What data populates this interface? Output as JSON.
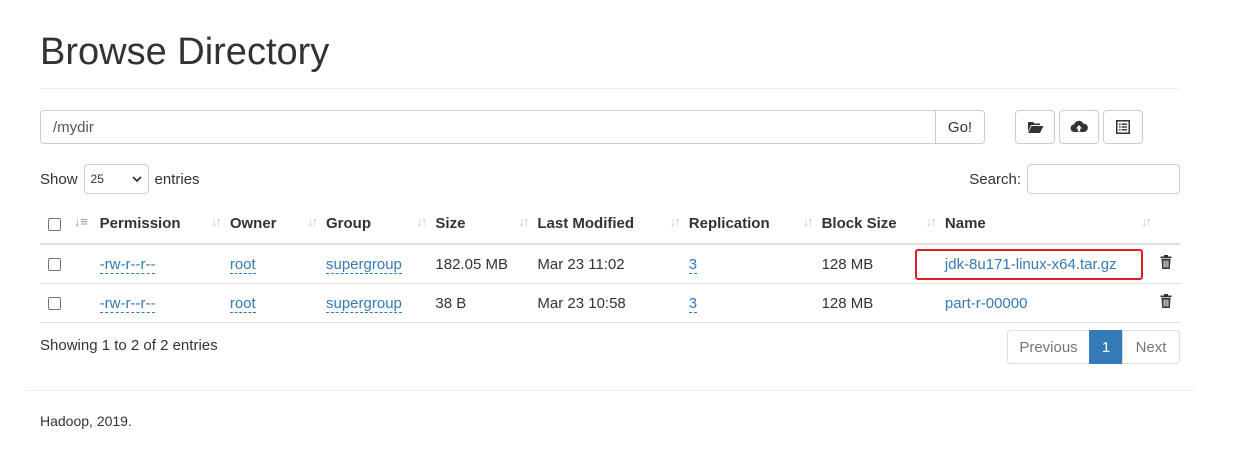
{
  "page": {
    "title": "Browse Directory"
  },
  "path_bar": {
    "value": "/mydir",
    "go_label": "Go!"
  },
  "toolbar": {
    "icons": [
      "folder-open-icon",
      "cloud-upload-icon",
      "list-alt-icon"
    ]
  },
  "entries_control": {
    "show_label": "Show",
    "selected": "25",
    "entries_label": "entries"
  },
  "search": {
    "label": "Search:",
    "value": ""
  },
  "table": {
    "columns": [
      "Permission",
      "Owner",
      "Group",
      "Size",
      "Last Modified",
      "Replication",
      "Block Size",
      "Name"
    ],
    "rows": [
      {
        "permission": "-rw-r--r--",
        "owner": "root",
        "group": "supergroup",
        "size": "182.05 MB",
        "last_modified": "Mar 23 11:02",
        "replication": "3",
        "block_size": "128 MB",
        "name": "jdk-8u171-linux-x64.tar.gz",
        "highlighted": true
      },
      {
        "permission": "-rw-r--r--",
        "owner": "root",
        "group": "supergroup",
        "size": "38 B",
        "last_modified": "Mar 23 10:58",
        "replication": "3",
        "block_size": "128 MB",
        "name": "part-r-00000",
        "highlighted": false
      }
    ]
  },
  "info": {
    "showing": "Showing 1 to 2 of 2 entries"
  },
  "pagination": {
    "previous": "Previous",
    "current": "1",
    "next": "Next"
  },
  "footer": {
    "text": "Hadoop, 2019."
  },
  "colors": {
    "link": "#337ab7",
    "highlight_border": "#e02020",
    "active_page": "#337ab7"
  }
}
